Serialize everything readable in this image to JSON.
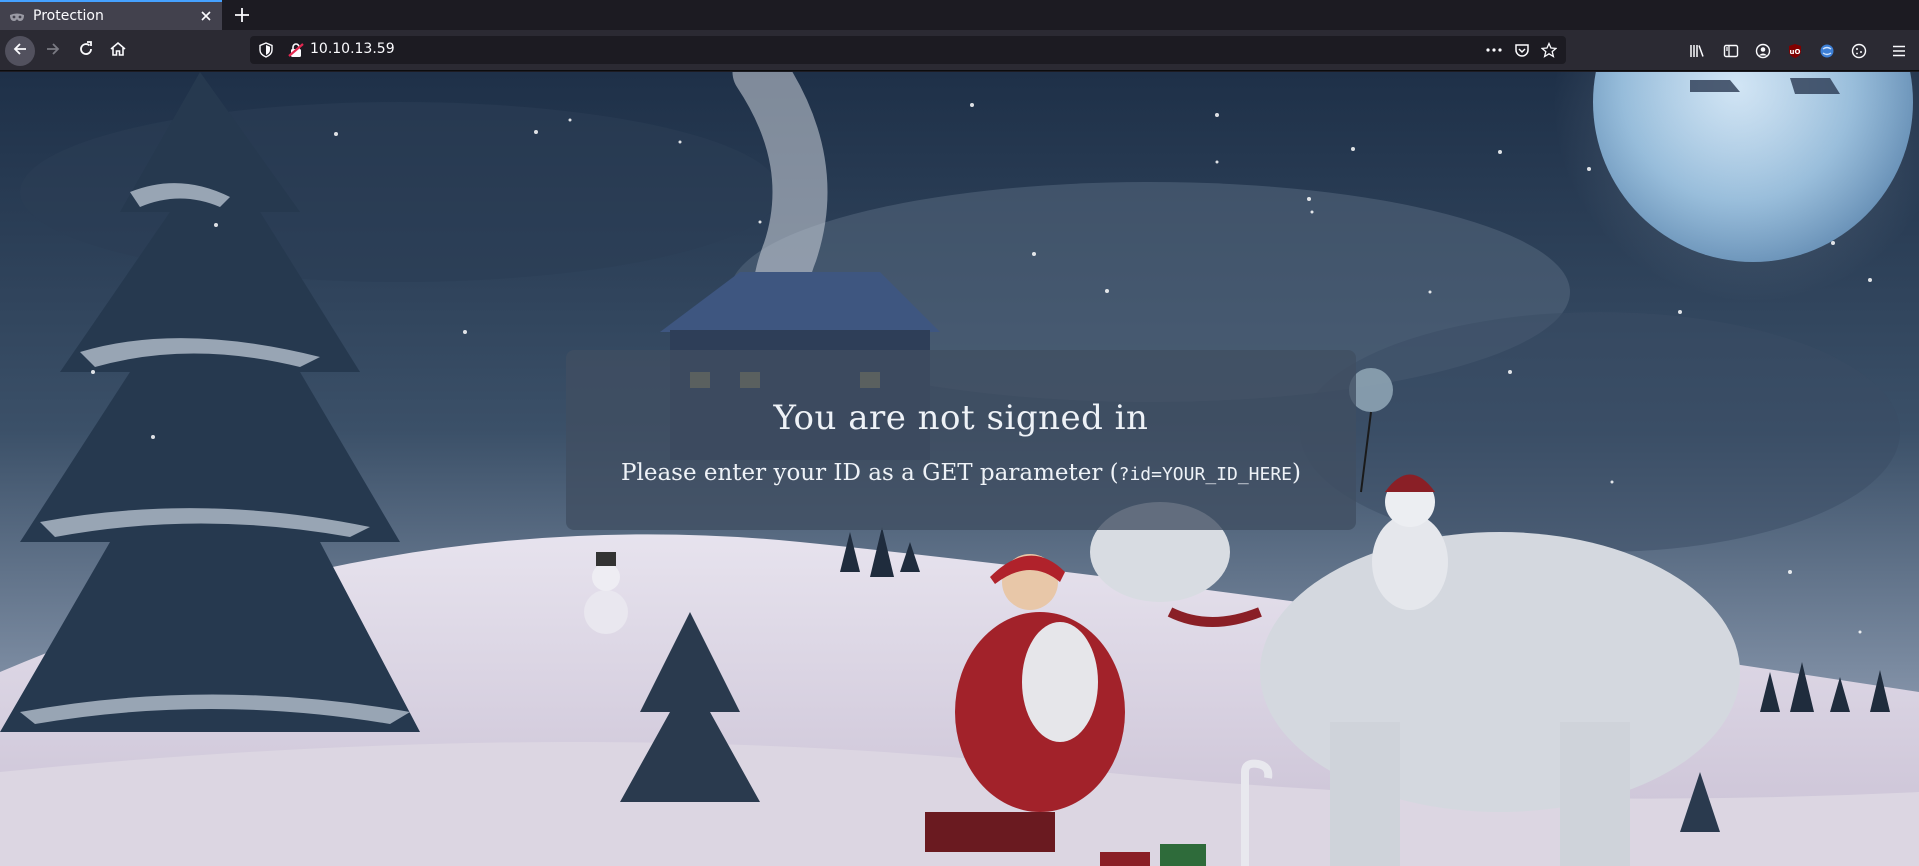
{
  "browser": {
    "tab": {
      "title": "Protection"
    },
    "url": "10.10.13.59"
  },
  "page": {
    "title": "You are not signed in",
    "message_prefix": "Please enter your ID as a GET parameter (",
    "message_code": "?id=YOUR_ID_HERE",
    "message_suffix": ")"
  },
  "icons": {
    "tab_favicon": "mask-icon",
    "tab_close": "close-icon",
    "new_tab": "plus-icon",
    "back": "back-arrow-icon",
    "forward": "forward-arrow-icon",
    "reload": "reload-icon",
    "home": "home-icon",
    "tracking_protection": "shield-icon",
    "insecure_connection": "insecure-lock-icon",
    "page_actions": "more-icon",
    "pocket": "pocket-icon",
    "bookmark": "star-icon",
    "library": "library-icon",
    "sidebar": "sidebar-icon",
    "account": "account-icon",
    "ublock": "ublock-icon",
    "extension_blue": "extension-icon",
    "cookie_extension": "cookie-icon",
    "menu": "hamburger-menu-icon"
  },
  "colors": {
    "toolbar": "#2b2a33",
    "tab_active": "#42414d",
    "accent": "#45a1ff",
    "panel": "#404e62"
  }
}
